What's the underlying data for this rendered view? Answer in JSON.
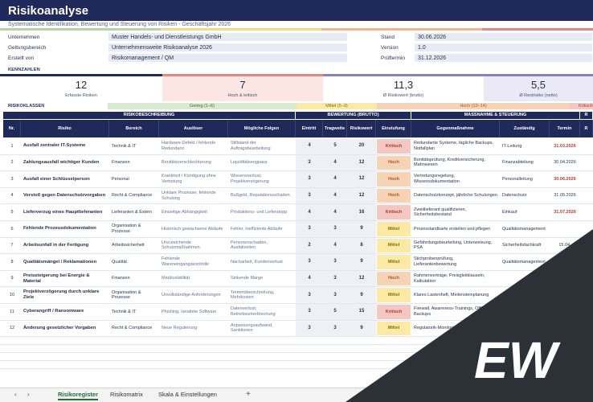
{
  "header": {
    "title": "Risikoanalyse",
    "subtitle": "Systematische Identifikation, Bewertung und Steuerung von Risiken - Geschäftsjahr 2026"
  },
  "info": {
    "company_label": "Unternehmen",
    "company": "Muster Handels- und Dienstleistungs GmbH",
    "scope_label": "Geltungsbereich",
    "scope": "Unternehmensweite Risikoanalyse 2026",
    "author_label": "Erstellt von",
    "author": "Risikomanagement / QM",
    "status_label": "Stand",
    "status": "30.06.2026",
    "version_label": "Version",
    "version": "1.0",
    "review_label": "Prüftermin",
    "review": "31.12.2026"
  },
  "kpi_section": "KENNZAHLEN",
  "kpis": [
    {
      "value": "12",
      "caption": "Erfasste Risiken"
    },
    {
      "value": "7",
      "caption": "Hoch & kritisch"
    },
    {
      "value": "11,3",
      "caption": "Ø Risikowert (brutto)"
    },
    {
      "value": "5,5",
      "caption": "Ø Restrisiko (netto)"
    }
  ],
  "classes": {
    "label": "RISIKOKLASSEN",
    "items": [
      "Gering (1–6)",
      "Mittel (5–9)",
      "Hoch (10–14)",
      "Kritisch"
    ]
  },
  "groups": [
    "RISIKOBESCHREIBUNG",
    "BEWERTUNG (BRUTTO)",
    "MASSNAHME & STEUERUNG",
    "R"
  ],
  "columns": [
    "Nr.",
    "Risiko",
    "Bereich",
    "Auslöser",
    "Mögliche Folgen",
    "Eintritt",
    "Tragweite",
    "Risikowert",
    "Einstufung",
    "Gegenmaßnahme",
    "Zuständig",
    "Termin",
    "R"
  ],
  "rows": [
    {
      "nr": "1",
      "risk": "Ausfall zentraler IT-Systeme",
      "area": "Technik & IT",
      "trigger": "Hardware-Defekt / fehlende Redundanz",
      "consequence": "Stillstand der Auftragsbearbeitung",
      "p": "4",
      "i": "5",
      "score": "20",
      "level": "Kritisch",
      "measure": "Redundante Systeme, tägliche Backups, Notfallplan",
      "owner": "IT-Leitung",
      "date": "31.03.2026",
      "overdue": true
    },
    {
      "nr": "2",
      "risk": "Zahlungsausfall wichtiger Kunden",
      "area": "Finanzen",
      "trigger": "Bonitätsverschlechterung",
      "consequence": "Liquiditätsengpass",
      "p": "3",
      "i": "4",
      "score": "12",
      "level": "Hoch",
      "measure": "Bonitätsprüfung, Kreditversicherung, Mahnwesen",
      "owner": "Finanzabteilung",
      "date": "30.04.2026",
      "overdue": false
    },
    {
      "nr": "3",
      "risk": "Ausfall einer Schlüsselperson",
      "area": "Personal",
      "trigger": "Krankheit / Kündigung ohne Vertretung",
      "consequence": "Wissensverlust, Projektverzögerung",
      "p": "3",
      "i": "4",
      "score": "12",
      "level": "Hoch",
      "measure": "Vertretungsregelung, Wissensdokumentation",
      "owner": "Personalleitung",
      "date": "30.06.2026",
      "overdue": true
    },
    {
      "nr": "4",
      "risk": "Verstoß gegen Datenschutzvorgaben",
      "area": "Recht & Compliance",
      "trigger": "Unklare Prozesse, fehlende Schulung",
      "consequence": "Bußgeld, Reputationsschaden",
      "p": "3",
      "i": "4",
      "score": "12",
      "level": "Hoch",
      "measure": "Datenschutzkonzept, jährliche Schulungen",
      "owner": "Datenschutz",
      "date": "31.05.2026",
      "overdue": false
    },
    {
      "nr": "5",
      "risk": "Lieferverzug eines Hauptlieferanten",
      "area": "Lieferanten & Extern",
      "trigger": "Einseitige Abhängigkeit",
      "consequence": "Produktions- und Lieferstopp",
      "p": "4",
      "i": "4",
      "score": "16",
      "level": "Kritisch",
      "measure": "Zweitlieferant qualifizieren, Sicherheitsbestand",
      "owner": "Einkauf",
      "date": "31.07.2026",
      "overdue": true
    },
    {
      "nr": "6",
      "risk": "Fehlende Prozessdokumentation",
      "area": "Organisation & Prozesse",
      "trigger": "Historisch gewachsene Abläufe",
      "consequence": "Fehler, ineffiziente Abläufe",
      "p": "3",
      "i": "3",
      "score": "9",
      "level": "Mittel",
      "measure": "Prozesslandkarte erstellen und pflegen",
      "owner": "Qualitätsmanagement",
      "date": "",
      "overdue": false
    },
    {
      "nr": "7",
      "risk": "Arbeitsunfall in der Fertigung",
      "area": "Arbeitssicherheit",
      "trigger": "Unzureichende Schutzmaßnahmen",
      "consequence": "Personenschaden, Ausfallzeiten",
      "p": "2",
      "i": "4",
      "score": "8",
      "level": "Mittel",
      "measure": "Gefährdungsbeurteilung, Unterweisung, PSA",
      "owner": "Sicherheitsfachkraft",
      "date": "15.04.",
      "overdue": false
    },
    {
      "nr": "8",
      "risk": "Qualitätsmängel / Reklamationen",
      "area": "Qualität",
      "trigger": "Fehlende Wareneingangskontrolle",
      "consequence": "Nacharbeit, Kundenverlust",
      "p": "3",
      "i": "3",
      "score": "9",
      "level": "Mittel",
      "measure": "Stichprobenprüfung, Lieferantenbewertung",
      "owner": "Qualitätsmanagement",
      "date": "",
      "overdue": false
    },
    {
      "nr": "9",
      "risk": "Preissteigerung bei Energie & Material",
      "area": "Finanzen",
      "trigger": "Marktvolatilität",
      "consequence": "Sinkende Marge",
      "p": "4",
      "i": "3",
      "score": "12",
      "level": "Hoch",
      "measure": "Rahmenverträge, Preisgleitklauseln, Kalkulation",
      "owner": "",
      "date": "",
      "overdue": false
    },
    {
      "nr": "10",
      "risk": "Projektverzögerung durch unklare Ziele",
      "area": "Organisation & Prozesse",
      "trigger": "Unvollständige Anforderungen",
      "consequence": "Terminüberschreitung, Mehrkosten",
      "p": "3",
      "i": "3",
      "score": "9",
      "level": "Mittel",
      "measure": "Klares Lastenheft, Meilensteinplanung",
      "owner": "",
      "date": "",
      "overdue": false
    },
    {
      "nr": "11",
      "risk": "Cyberangriff / Ransomware",
      "area": "Technik & IT",
      "trigger": "Phishing, veraltete Software",
      "consequence": "Datenverlust, Betriebsunterbrechung",
      "p": "3",
      "i": "5",
      "score": "15",
      "level": "Kritisch",
      "measure": "Firewall, Awareness-Trainings, Offline-Backups",
      "owner": "",
      "date": "",
      "overdue": false
    },
    {
      "nr": "12",
      "risk": "Änderung gesetzlicher Vorgaben",
      "area": "Recht & Compliance",
      "trigger": "Neue Regulierung",
      "consequence": "Anpassungsaufwand, Sanktionen",
      "p": "3",
      "i": "3",
      "score": "9",
      "level": "Mittel",
      "measure": "Regulatorik-Monitoring",
      "owner": "",
      "date": "",
      "overdue": false
    }
  ],
  "tabs": {
    "nav_prev": "‹",
    "nav_next": "›",
    "items": [
      "Risikoregister",
      "Risikomatrix",
      "Skala & Einstellungen"
    ],
    "add": "+"
  },
  "logo_text": "EW",
  "colors": {
    "navy": "#1f2a5a",
    "critical_bg": "#f4c7c3",
    "critical_fg": "#b03a2e",
    "high_bg": "#f7d3b5",
    "high_fg": "#b0541e",
    "medium_bg": "#fbeaa5",
    "medium_fg": "#8a6d00",
    "low_bg": "#d6ead0"
  }
}
